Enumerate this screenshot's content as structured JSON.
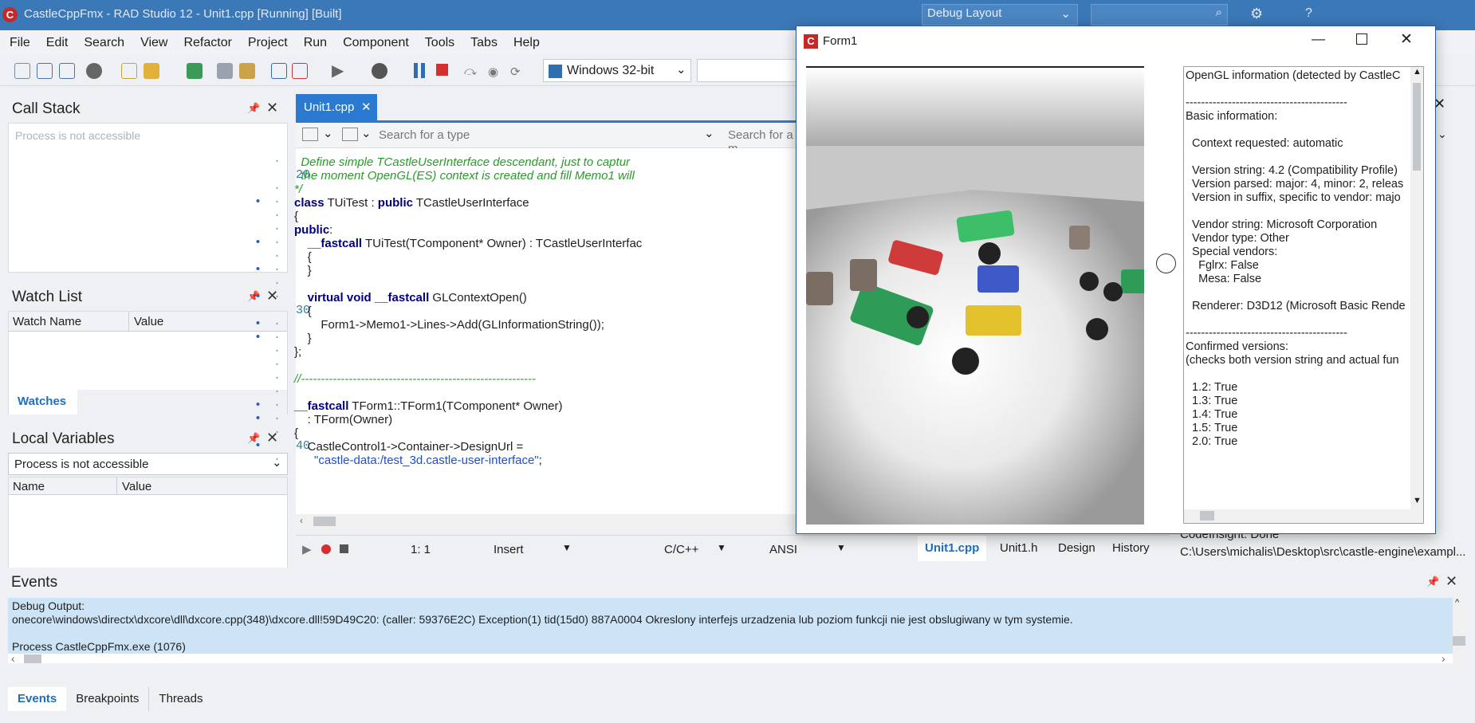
{
  "window": {
    "title": "CastleCppFmx - RAD Studio 12 - Unit1.cpp [Running] [Built]",
    "layout": "Debug Layout",
    "search_placeholder": ""
  },
  "menu": [
    "File",
    "Edit",
    "Search",
    "View",
    "Refactor",
    "Project",
    "Run",
    "Component",
    "Tools",
    "Tabs",
    "Help"
  ],
  "toolbar": {
    "platform": "Windows 32-bit"
  },
  "call_stack": {
    "title": "Call Stack",
    "status": "Process is not accessible"
  },
  "watch_list": {
    "title": "Watch List",
    "col_name": "Watch Name",
    "col_value": "Value",
    "tab": "Watches"
  },
  "local_vars": {
    "title": "Local Variables",
    "combo": "Process is not accessible",
    "col_name": "Name",
    "col_value": "Value"
  },
  "editor": {
    "tab": "Unit1.cpp",
    "search_type_placeholder": "Search for a type",
    "search_member_placeholder": "Search for a m",
    "lines": [
      {
        "n": "",
        "dot": false,
        "segs": [
          {
            "t": "  Define simple TCastleUserInterface descendant, just to captur",
            "c": "cm"
          }
        ]
      },
      {
        "n": "20",
        "dot": false,
        "segs": [
          {
            "t": "  the moment OpenGL(ES) context is created and fill Memo1 will",
            "c": "cm"
          }
        ]
      },
      {
        "n": "",
        "dot": false,
        "segs": [
          {
            "t": "*/",
            "c": "cm"
          }
        ]
      },
      {
        "n": "",
        "dot": true,
        "segs": [
          {
            "t": "class",
            "c": "kw"
          },
          {
            "t": " TUiTest : ",
            "c": ""
          },
          {
            "t": "public",
            "c": "kw"
          },
          {
            "t": " TCastleUserInterface",
            "c": ""
          }
        ]
      },
      {
        "n": "",
        "dot": false,
        "segs": [
          {
            "t": "{",
            "c": ""
          }
        ]
      },
      {
        "n": "",
        "dot": false,
        "segs": [
          {
            "t": "public",
            "c": "kw"
          },
          {
            "t": ":",
            "c": ""
          }
        ]
      },
      {
        "n": "",
        "dot": true,
        "segs": [
          {
            "t": "    ",
            "c": ""
          },
          {
            "t": "__fastcall",
            "c": "kw"
          },
          {
            "t": " TUiTest(TComponent* Owner) : TCastleUserInterfac",
            "c": ""
          }
        ]
      },
      {
        "n": "",
        "dot": false,
        "segs": [
          {
            "t": "    {",
            "c": ""
          }
        ]
      },
      {
        "n": "",
        "dot": true,
        "segs": [
          {
            "t": "    }",
            "c": ""
          }
        ]
      },
      {
        "n": "",
        "dot": false,
        "segs": [
          {
            "t": "",
            "c": ""
          }
        ]
      },
      {
        "n": "",
        "dot": true,
        "segs": [
          {
            "t": "    ",
            "c": ""
          },
          {
            "t": "virtual void __fastcall",
            "c": "kw"
          },
          {
            "t": " GLContextOpen()",
            "c": ""
          }
        ]
      },
      {
        "n": "30",
        "dot": false,
        "segs": [
          {
            "t": "    {",
            "c": ""
          }
        ]
      },
      {
        "n": "",
        "dot": true,
        "segs": [
          {
            "t": "        Form1->Memo1->Lines->Add(GLInformationString());",
            "c": ""
          }
        ]
      },
      {
        "n": "",
        "dot": true,
        "segs": [
          {
            "t": "    }",
            "c": ""
          }
        ]
      },
      {
        "n": "",
        "dot": false,
        "segs": [
          {
            "t": "};",
            "c": ""
          }
        ]
      },
      {
        "n": "",
        "dot": false,
        "segs": [
          {
            "t": "",
            "c": ""
          }
        ]
      },
      {
        "n": "",
        "dot": false,
        "segs": [
          {
            "t": "//-----------------------------------------------------------",
            "c": "cm"
          }
        ]
      },
      {
        "n": "",
        "dot": false,
        "segs": [
          {
            "t": "",
            "c": ""
          }
        ]
      },
      {
        "n": "",
        "dot": true,
        "segs": [
          {
            "t": "__fastcall",
            "c": "kw"
          },
          {
            "t": " TForm1::TForm1(TComponent* Owner)",
            "c": ""
          }
        ]
      },
      {
        "n": "",
        "dot": true,
        "segs": [
          {
            "t": "    : TForm(Owner)",
            "c": ""
          }
        ]
      },
      {
        "n": "",
        "dot": false,
        "segs": [
          {
            "t": "{",
            "c": ""
          }
        ]
      },
      {
        "n": "40",
        "dot": true,
        "segs": [
          {
            "t": "    CastleControl1->Container->DesignUrl =",
            "c": ""
          }
        ]
      },
      {
        "n": "",
        "dot": false,
        "segs": [
          {
            "t": "      ",
            "c": ""
          },
          {
            "t": "\"castle-data:/test_3d.castle-user-interface\"",
            "c": "st"
          },
          {
            "t": ";",
            "c": ""
          }
        ]
      }
    ],
    "status": {
      "pos": "1:   1",
      "mode": "Insert",
      "lang": "C/C++",
      "enc": "ANSI"
    },
    "bottom_tabs": [
      "Unit1.cpp",
      "Unit1.h",
      "Design",
      "History"
    ]
  },
  "right_panel": {
    "codeinsight": "CodeInsight: Done",
    "path": "C:\\Users\\michalis\\Desktop\\src\\castle-engine\\exampl..."
  },
  "form1": {
    "title": "Form1",
    "memo": [
      "OpenGL information (detected by CastleC",
      "",
      "------------------------------------------",
      "Basic information:",
      "",
      "  Context requested: automatic",
      "",
      "  Version string: 4.2 (Compatibility Profile)",
      "  Version parsed: major: 4, minor: 2, releas",
      "  Version in suffix, specific to vendor: majo",
      "",
      "  Vendor string: Microsoft Corporation",
      "  Vendor type: Other",
      "  Special vendors:",
      "    Fglrx: False",
      "    Mesa: False",
      "",
      "  Renderer: D3D12 (Microsoft Basic Rende",
      "",
      "------------------------------------------",
      "Confirmed versions:",
      "(checks both version string and actual fun",
      "",
      "  1.2: True",
      "  1.3: True",
      "  1.4: True",
      "  1.5: True",
      "  2.0: True"
    ]
  },
  "events": {
    "title": "Events",
    "lines": [
      "Debug Output:",
      "onecore\\windows\\directx\\dxcore\\dll\\dxcore.cpp(348)\\dxcore.dll!59D49C20: (caller: 59376E2C) Exception(1) tid(15d0) 887A0004 Okreslony interfejs urzadzenia lub poziom funkcji nie jest obslugiwany w tym systemie.",
      "",
      "Process CastleCppFmx.exe (1076)"
    ],
    "tabs": [
      "Events",
      "Breakpoints",
      "Threads"
    ]
  }
}
